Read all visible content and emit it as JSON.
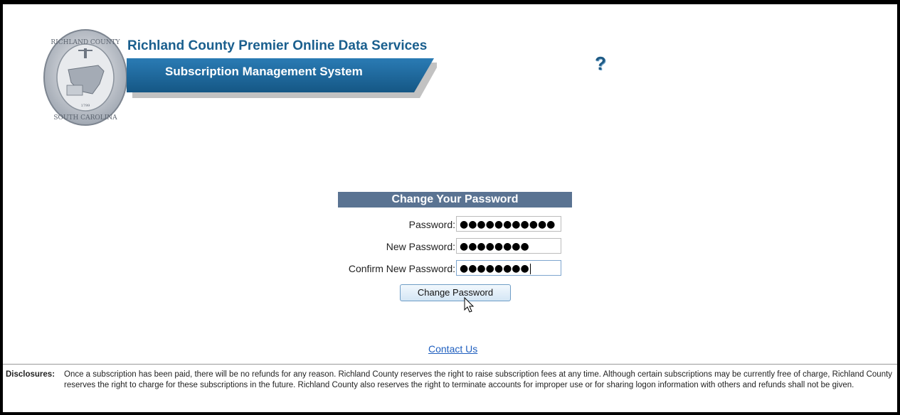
{
  "header": {
    "title": "Richland County Premier Online Data Services",
    "subtitle": "Subscription Management System",
    "seal_text_top": "RICHLAND COUNTY",
    "seal_text_bottom": "SOUTH CAROLINA",
    "seal_year": "1799",
    "help_icon": "help-icon",
    "help_symbol": "?",
    "colors": {
      "title": "#1a5f8e",
      "banner": "#1f6aa0"
    }
  },
  "form": {
    "heading": "Change Your Password",
    "fields": [
      {
        "label": "Password:",
        "value": "●●●●●●●●●●●"
      },
      {
        "label": "New Password:",
        "value": "●●●●●●●●"
      },
      {
        "label": "Confirm New Password:",
        "value": "●●●●●●●●"
      }
    ],
    "submit_label": "Change Password",
    "heading_color": "#5a7392"
  },
  "footer": {
    "contact_label": "Contact Us",
    "disclosures_label": "Disclosures:",
    "disclosures_text": "Once a subscription has been paid, there will be no refunds for any reason. Richland County reserves the right to raise subscription fees at any time. Although certain subscriptions may be currently free of charge, Richland County reserves the right to charge for these subscriptions in the future. Richland County also reserves the right to terminate accounts for improper use or for sharing logon information with others and refunds shall not be given."
  }
}
